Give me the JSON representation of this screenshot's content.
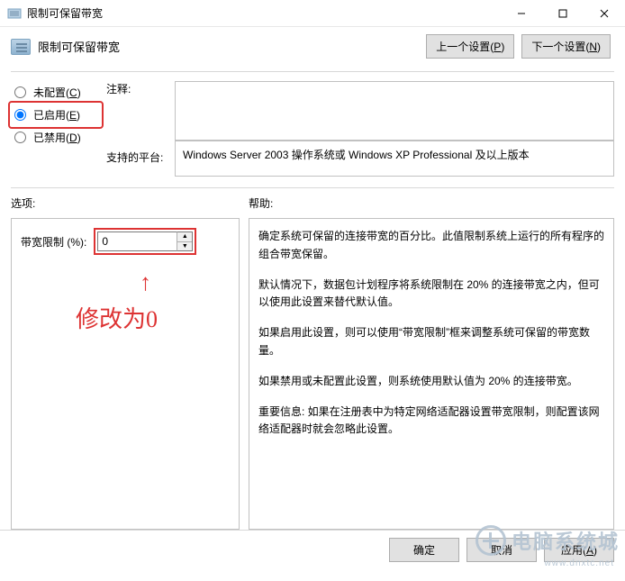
{
  "window": {
    "title": "限制可保留带宽"
  },
  "header": {
    "label": "限制可保留带宽",
    "prev_btn": "上一个设置",
    "prev_mn": "P",
    "next_btn": "下一个设置",
    "next_mn": "N"
  },
  "radios": {
    "not_configured": "未配置",
    "not_configured_mn": "C",
    "enabled": "已启用",
    "enabled_mn": "E",
    "disabled": "已禁用",
    "disabled_mn": "D",
    "selected": "enabled"
  },
  "labels": {
    "comment": "注释:",
    "platform": "支持的平台:",
    "options": "选项:",
    "help": "帮助:",
    "bandwidth_limit": "带宽限制 (%):"
  },
  "values": {
    "comment": "",
    "platform": "Windows Server 2003 操作系统或 Windows XP Professional 及以上版本",
    "bandwidth_limit": "0"
  },
  "help_paragraphs": [
    "确定系统可保留的连接带宽的百分比。此值限制系统上运行的所有程序的组合带宽保留。",
    "默认情况下，数据包计划程序将系统限制在 20% 的连接带宽之内，但可以使用此设置来替代默认值。",
    "如果启用此设置，则可以使用“带宽限制”框来调整系统可保留的带宽数量。",
    "如果禁用或未配置此设置，则系统使用默认值为 20% 的连接带宽。",
    "重要信息: 如果在注册表中为特定网络适配器设置带宽限制，则配置该网络适配器时就会忽略此设置。"
  ],
  "annotation": {
    "text": "修改为0"
  },
  "buttons": {
    "ok": "确定",
    "cancel": "取消",
    "apply": "应用",
    "apply_mn": "A"
  },
  "watermark": {
    "main": "电脑系统城",
    "sub": "www.dnxtc.net"
  }
}
